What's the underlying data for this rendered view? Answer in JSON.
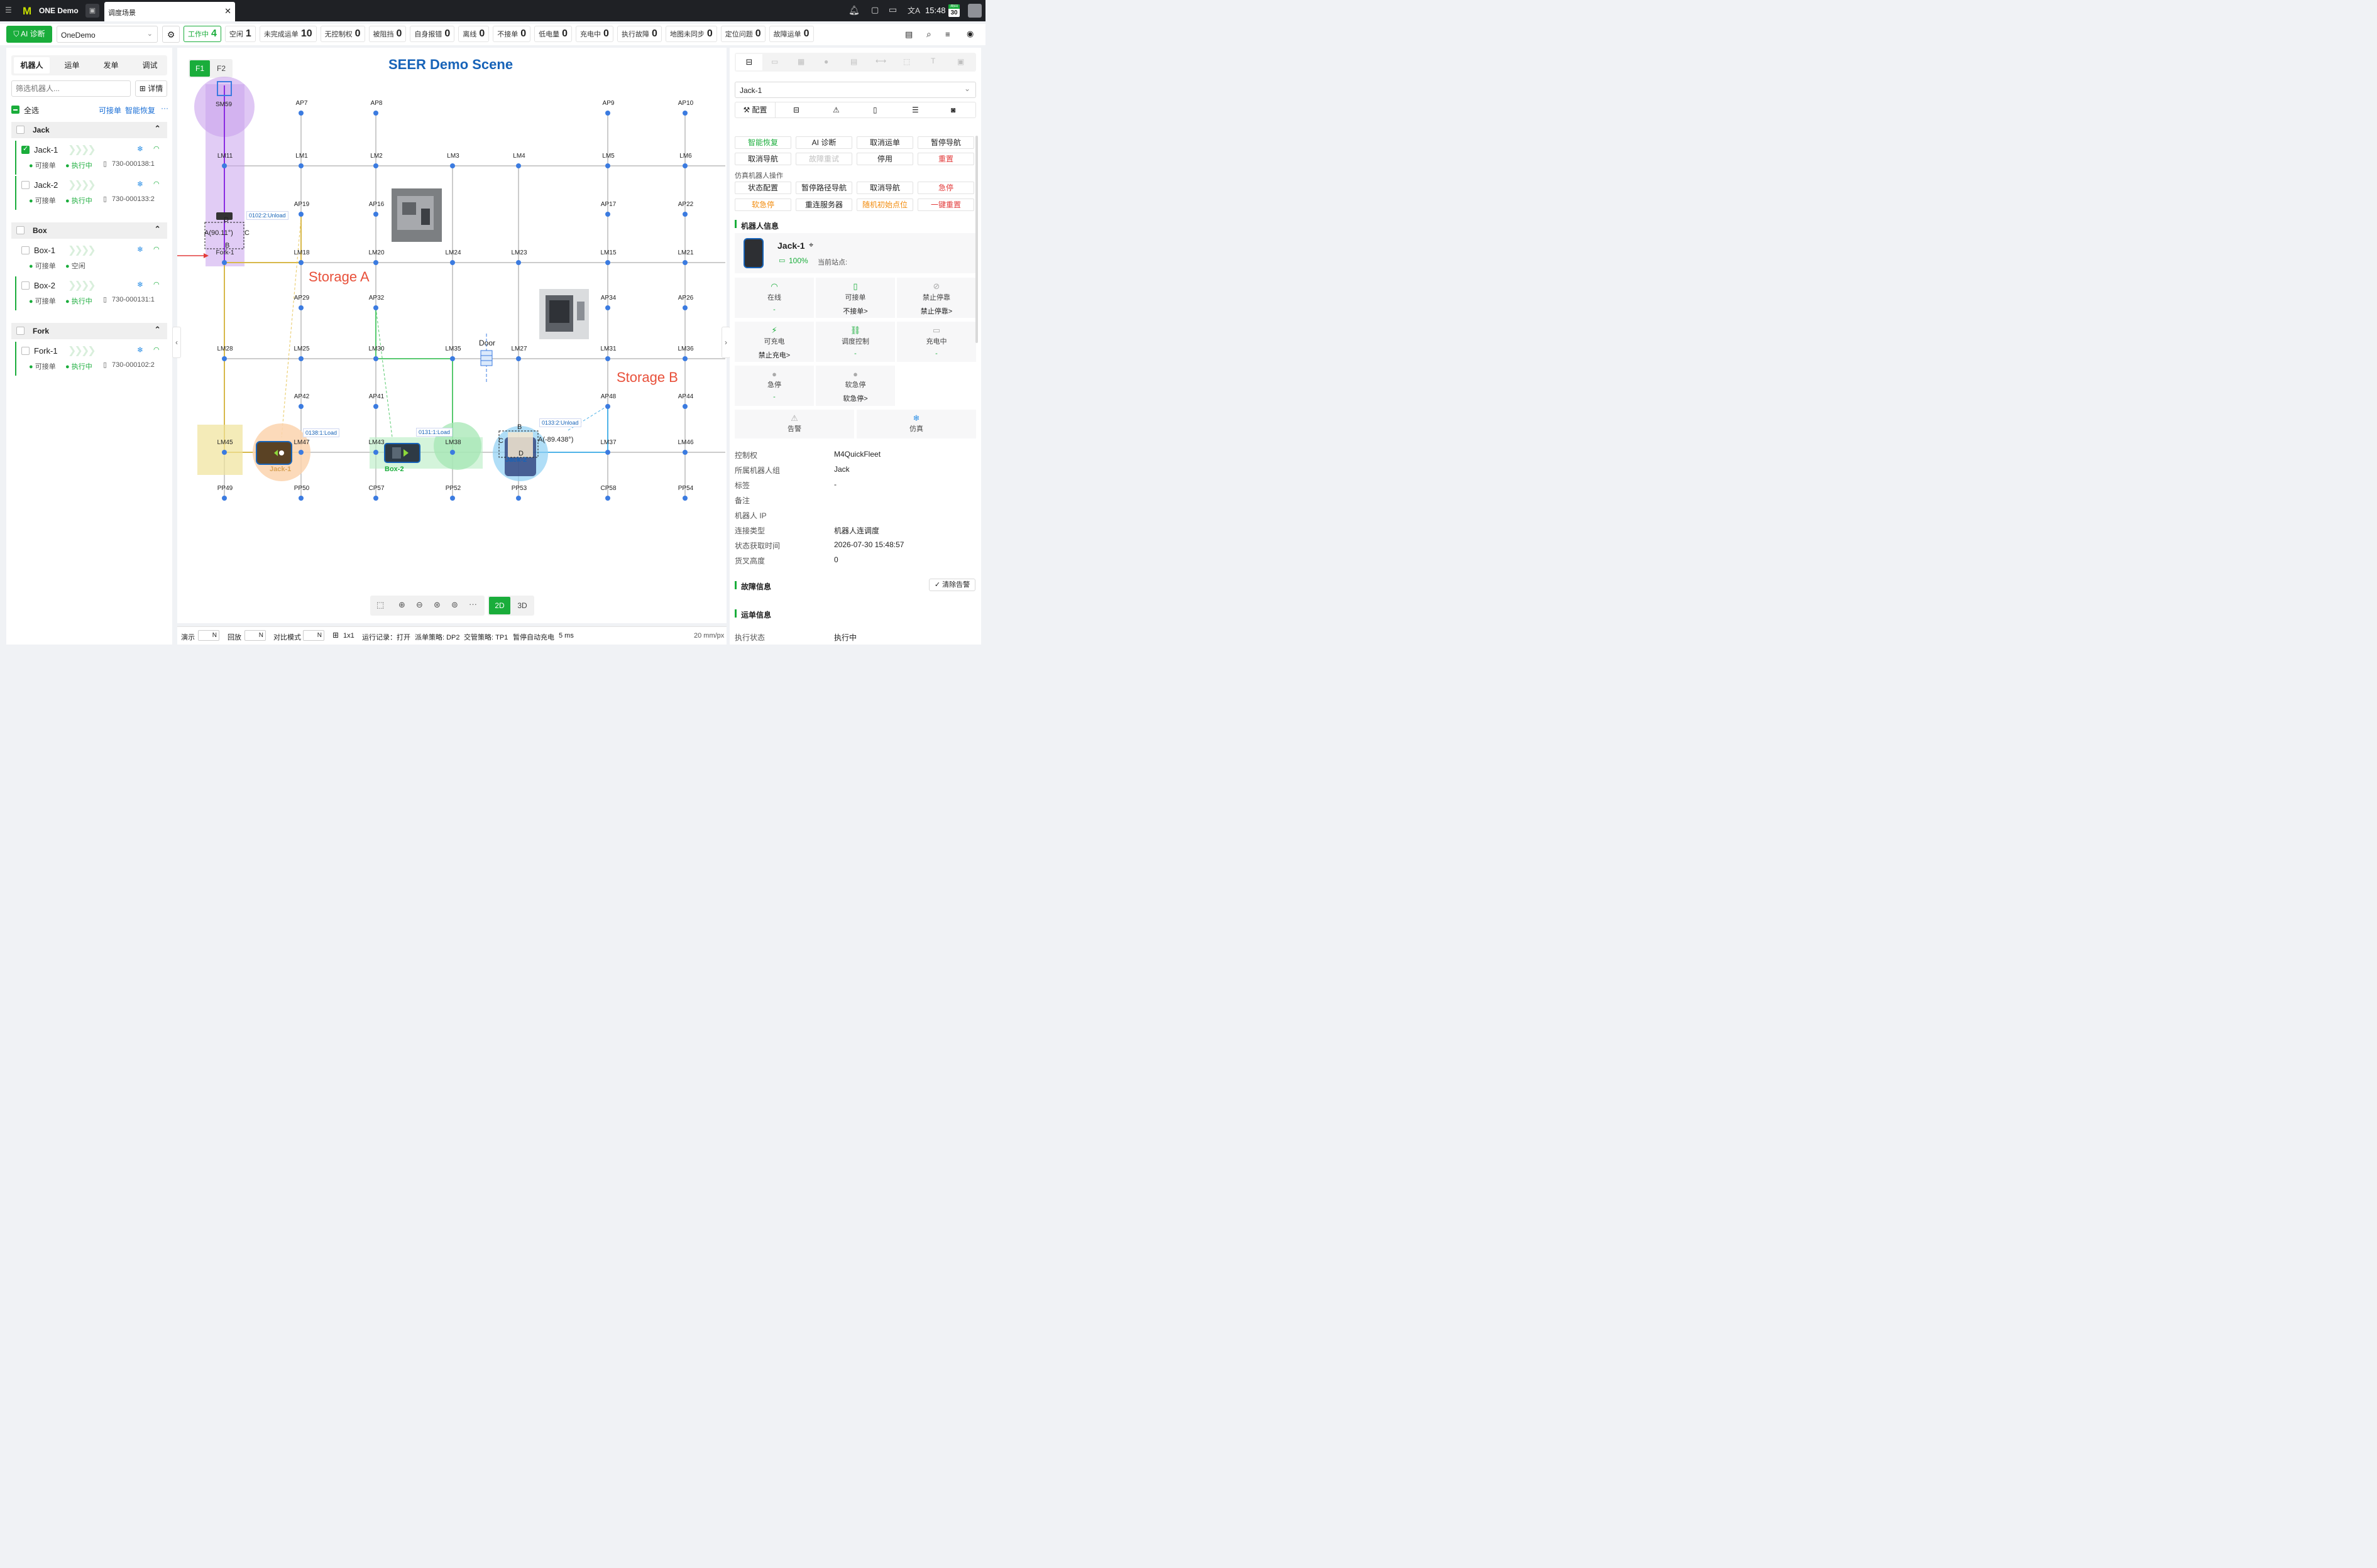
{
  "topbar": {
    "app_name": "ONE Demo",
    "tab_title": "调度场景",
    "time": "15:48",
    "calendar_day": "30",
    "calendar_month": "周四"
  },
  "toolbar": {
    "ai_btn": "AI 诊断",
    "scene_select": "OneDemo",
    "stats": [
      {
        "label": "工作中",
        "value": "4"
      },
      {
        "label": "空闲",
        "value": "1"
      },
      {
        "label": "未完成运单",
        "value": "10"
      },
      {
        "label": "无控制权",
        "value": "0"
      },
      {
        "label": "被阻挡",
        "value": "0"
      },
      {
        "label": "自身报错",
        "value": "0"
      },
      {
        "label": "离线",
        "value": "0"
      },
      {
        "label": "不接单",
        "value": "0"
      },
      {
        "label": "低电量",
        "value": "0"
      },
      {
        "label": "充电中",
        "value": "0"
      },
      {
        "label": "执行故障",
        "value": "0"
      },
      {
        "label": "地图未同步",
        "value": "0"
      },
      {
        "label": "定位问题",
        "value": "0"
      },
      {
        "label": "故障运单",
        "value": "0"
      }
    ]
  },
  "left": {
    "tabs": [
      "机器人",
      "运单",
      "发单",
      "调试"
    ],
    "search_placeholder": "筛选机器人...",
    "detail_btn": "详情",
    "select_all": "全选",
    "link_orders": "可接单",
    "link_recover": "智能恢复",
    "more": "···",
    "groups": [
      {
        "name": "Jack",
        "robots": [
          {
            "name": "Jack-1",
            "status1": "可接单",
            "status2": "执行中",
            "order": "730-000138:1",
            "checked": true
          },
          {
            "name": "Jack-2",
            "status1": "可接单",
            "status2": "执行中",
            "order": "730-000133:2",
            "checked": false
          }
        ]
      },
      {
        "name": "Box",
        "robots": [
          {
            "name": "Box-1",
            "status1": "可接单",
            "status2": "空闲",
            "order": "",
            "checked": false
          },
          {
            "name": "Box-2",
            "status1": "可接单",
            "status2": "执行中",
            "order": "730-000131:1",
            "checked": false
          }
        ]
      },
      {
        "name": "Fork",
        "robots": [
          {
            "name": "Fork-1",
            "status1": "可接单",
            "status2": "执行中",
            "order": "730-000102:2",
            "checked": false
          }
        ]
      }
    ]
  },
  "map": {
    "title": "SEER Demo Scene",
    "floors": [
      "F1",
      "F2"
    ],
    "storage_a": "Storage A",
    "storage_b": "Storage B",
    "door": "Door",
    "nodes_ap_top": [
      "AP7",
      "AP8",
      "AP9",
      "AP10"
    ],
    "nodes_row1": [
      "LM11",
      "LM1",
      "LM2",
      "LM3",
      "LM4",
      "LM5",
      "LM6"
    ],
    "nodes_ap_row2": [
      "AP19",
      "AP16",
      "AP17",
      "AP22"
    ],
    "nodes_row2": [
      "Fork-1",
      "LM18",
      "LM20",
      "LM24",
      "LM23",
      "LM15",
      "LM21"
    ],
    "nodes_ap_row3": [
      "AP29",
      "AP32",
      "AP34",
      "AP26"
    ],
    "nodes_row3": [
      "LM28",
      "LM25",
      "LM30",
      "LM35",
      "LM27",
      "LM31",
      "LM36"
    ],
    "nodes_ap_row4": [
      "AP42",
      "AP41",
      "AP48",
      "AP44"
    ],
    "nodes_row4": [
      "LM45",
      "LM47",
      "LM43",
      "LM38",
      "LM37",
      "LM46"
    ],
    "nodes_row5": [
      "PP49",
      "PP50",
      "CP57",
      "PP52",
      "PP53",
      "CP58",
      "PP54"
    ],
    "sm_node": "SM59",
    "robot_labels": [
      "Jack-1",
      "Box-2",
      "Jack-2"
    ],
    "task_tags": [
      "0102:2:Unload",
      "0138:1:Load",
      "0131:1:Load",
      "0133:2:Unload"
    ],
    "fork_angle": "A(90.11°)",
    "jack2_angle": "A(-89.438°)",
    "letters": {
      "b": "B",
      "c": "C",
      "d": "D"
    },
    "view_2d": "2D",
    "view_3d": "3D",
    "more_tools": "···"
  },
  "status": {
    "demo": "演示",
    "playback": "回放",
    "compare": "对比模式",
    "toggle_n": "N",
    "grid": "1x1",
    "run_log": "运行记录：打开",
    "dispatch": "派单策略: DP2",
    "traffic": "交管策略: TP1",
    "charge": "暂停自动充电",
    "interval": "5 ms",
    "scale": "20 mm/px"
  },
  "right": {
    "robot_select": "Jack-1",
    "config_btn": "配置",
    "actions_row1": [
      "智能恢复",
      "AI 诊断",
      "取消运单",
      "暂停导航"
    ],
    "actions_row2": [
      "取消导航",
      "故障重试",
      "停用",
      "重置"
    ],
    "sim_title": "仿真机器人操作",
    "sim_row1": [
      "状态配置",
      "暂停路径导航",
      "取消导航",
      "急停"
    ],
    "sim_row2": [
      "软急停",
      "重连服务器",
      "随机初始点位",
      "一键重置"
    ],
    "info_title": "机器人信息",
    "robot_name": "Jack-1",
    "battery": "100%",
    "current_station": "当前站点:",
    "tiles": [
      {
        "title": "在线",
        "value": "-"
      },
      {
        "title": "可接单",
        "value": "不接单>"
      },
      {
        "title": "禁止停靠",
        "value": "禁止停靠>"
      },
      {
        "title": "可充电",
        "value": "禁止充电>"
      },
      {
        "title": "调度控制",
        "value": "-"
      },
      {
        "title": "充电中",
        "value": "-"
      },
      {
        "title": "急停",
        "value": "-"
      },
      {
        "title": "软急停",
        "value": "软急停>"
      }
    ],
    "alarm": "告警",
    "sim": "仿真",
    "kv": [
      {
        "k": "控制权",
        "v": "M4QuickFleet"
      },
      {
        "k": "所属机器人组",
        "v": "Jack"
      },
      {
        "k": "标签",
        "v": "-"
      },
      {
        "k": "备注",
        "v": ""
      },
      {
        "k": "机器人 IP",
        "v": ""
      },
      {
        "k": "连接类型",
        "v": "机器人连调度"
      },
      {
        "k": "状态获取时间",
        "v": "2026-07-30 15:48:57"
      },
      {
        "k": "货叉高度",
        "v": "0"
      }
    ],
    "fault_title": "故障信息",
    "clear_alarm": "清除告警",
    "order_title": "运单信息",
    "exec_state_k": "执行状态",
    "exec_state_v": "执行中"
  }
}
